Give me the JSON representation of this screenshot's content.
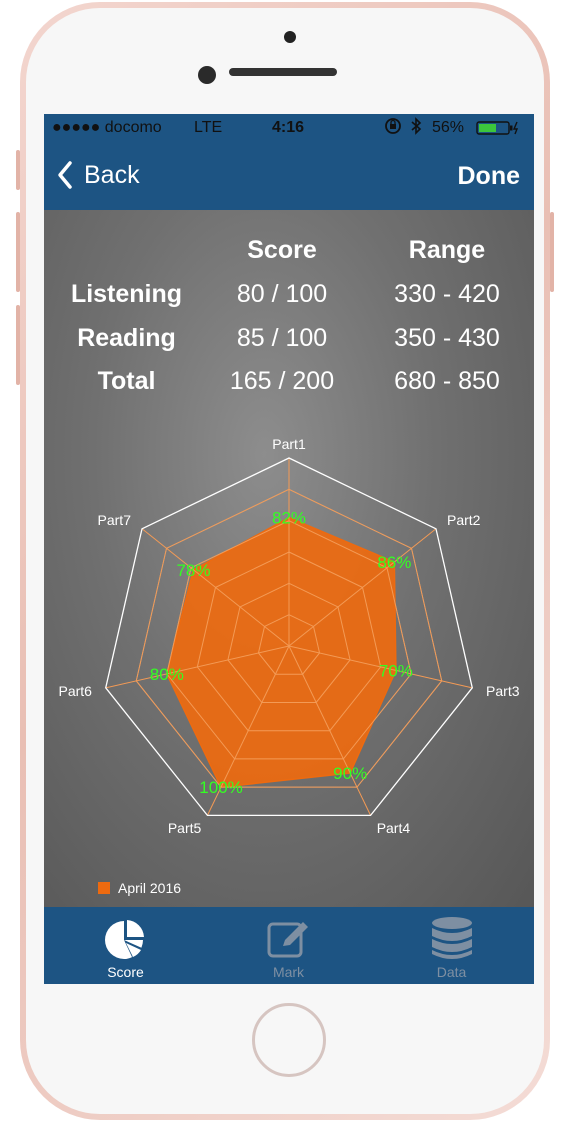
{
  "status_bar": {
    "carrier": "●●●●● docomo",
    "network": "LTE",
    "time": "4:16",
    "battery": "56%"
  },
  "nav": {
    "back_label": "Back",
    "done_label": "Done"
  },
  "score_table": {
    "headers": {
      "score": "Score",
      "range": "Range"
    },
    "rows": [
      {
        "label": "Listening",
        "score": "80 / 100",
        "range": "330 - 420"
      },
      {
        "label": "Reading",
        "score": "85 / 100",
        "range": "350 - 430"
      },
      {
        "label": "Total",
        "score": "165 / 200",
        "range": "680 - 850"
      }
    ]
  },
  "chart_data": {
    "type": "radar",
    "categories": [
      "Part1",
      "Part2",
      "Part3",
      "Part4",
      "Part5",
      "Part6",
      "Part7"
    ],
    "series": [
      {
        "name": "April 2016",
        "values": [
          82,
          86,
          70,
          90,
          100,
          80,
          78
        ]
      }
    ],
    "value_labels": [
      "82%",
      "86%",
      "70%",
      "90%",
      "100%",
      "80%",
      "78%"
    ],
    "range": [
      0,
      120
    ],
    "grid_levels": 6,
    "series_color": "#ee6a0f",
    "label_color": "#33ff22",
    "legend_position": "bottom-left"
  },
  "tabs": [
    {
      "label": "Score",
      "icon": "pie-chart-icon",
      "active": true
    },
    {
      "label": "Mark",
      "icon": "edit-icon",
      "active": false
    },
    {
      "label": "Data",
      "icon": "database-icon",
      "active": false
    }
  ],
  "colors": {
    "nav_bar": "#1d5483",
    "active_tab": "#ffffff",
    "inactive_tab": "#7e8fa2"
  }
}
